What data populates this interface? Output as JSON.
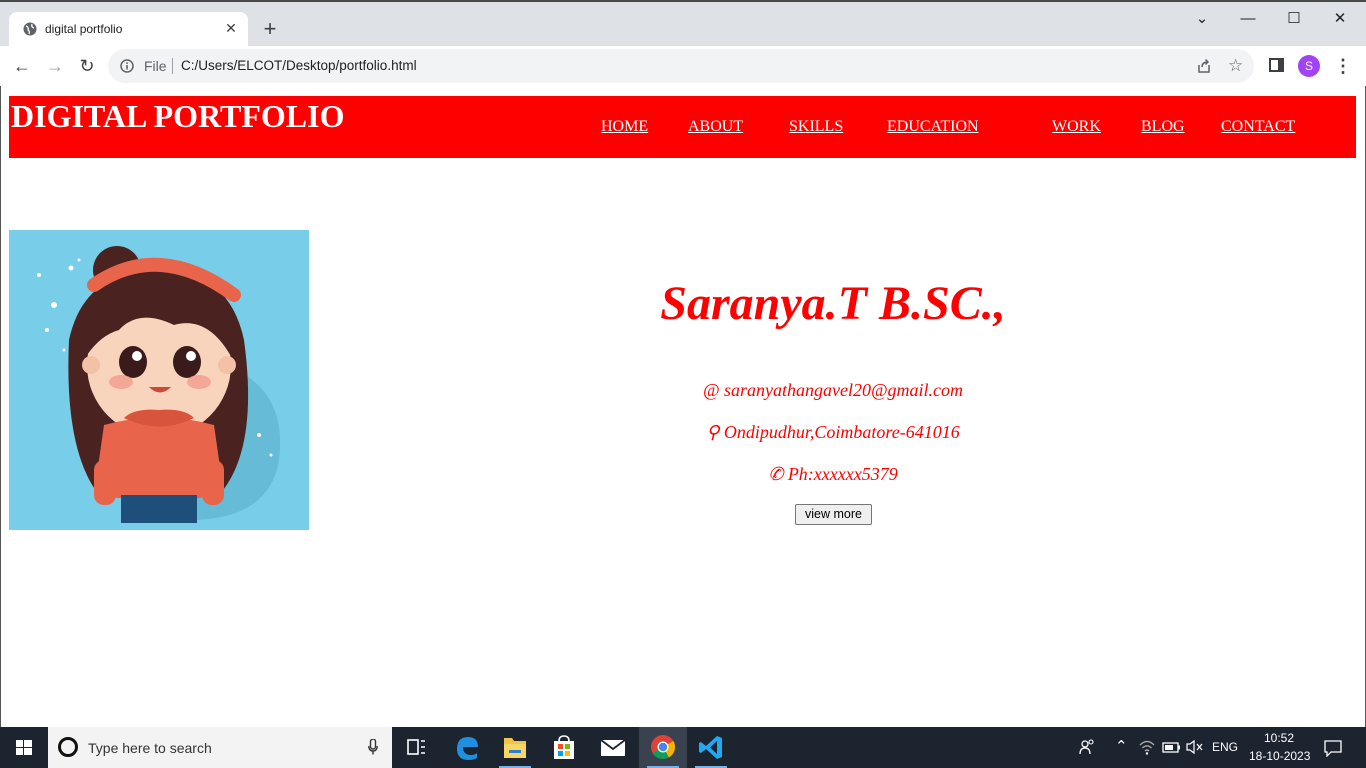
{
  "browser": {
    "tab_title": "digital portfolio",
    "tab_close": "✕",
    "new_tab": "+",
    "window_controls": {
      "dropdown": "⌄",
      "minimize": "—",
      "maximize": "☐",
      "close": "✕"
    },
    "nav": {
      "back": "←",
      "forward": "→",
      "reload": "↻"
    },
    "address": {
      "scheme_label": "File",
      "url": "C:/Users/ELCOT/Desktop/portfolio.html"
    },
    "profile_initial": "S",
    "menu": "⋮",
    "star": "☆"
  },
  "site": {
    "title": "DIGITAL PORTFOLIO",
    "nav": [
      "HOME",
      "ABOUT",
      "SKILLS",
      "EDUCATION",
      "WORK",
      "BLOG",
      "CONTACT"
    ],
    "name": "Saranya.T B.SC.,",
    "email": "@ saranyathangavel20@gmail.com",
    "address": "⚲ Ondipudhur,Coimbatore-641016",
    "phone": "✆ Ph:xxxxxx5379",
    "button": "view more",
    "colors": {
      "header_bg": "#ff0000",
      "text_accent": "#ff0000",
      "portrait_bg": "#78cde8"
    }
  },
  "taskbar": {
    "search_placeholder": "Type here to search",
    "language": "ENG",
    "time": "10:52",
    "date": "18-10-2023"
  }
}
